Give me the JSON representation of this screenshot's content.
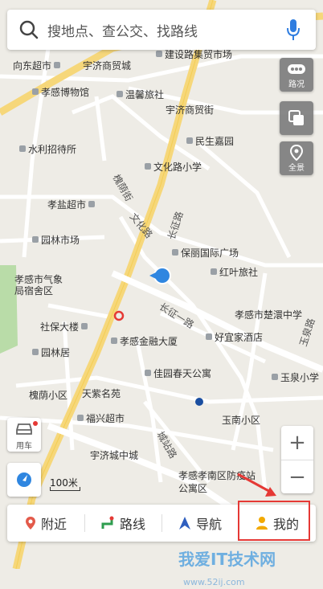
{
  "search": {
    "placeholder": "搜地点、查公交、找路线"
  },
  "side_buttons": {
    "traffic": "路况",
    "panorama": "全景"
  },
  "left_buttons": {
    "car": "用车"
  },
  "zoom": {
    "plus": "+",
    "minus": "−"
  },
  "scale": "100米",
  "bottom_nav": [
    {
      "label": "附近"
    },
    {
      "label": "路线"
    },
    {
      "label": "导航"
    },
    {
      "label": "我的"
    }
  ],
  "watermark": {
    "text": "我爱IT技术网",
    "url": "www.52ij.com"
  },
  "pois": [
    {
      "name": "建设路集贸市场"
    },
    {
      "name": "向东超市"
    },
    {
      "name": "宇济商贸城"
    },
    {
      "name": "孝感博物馆"
    },
    {
      "name": "温馨旅社"
    },
    {
      "name": "宇济商贸街"
    },
    {
      "name": "民生嘉园"
    },
    {
      "name": "水利招待所"
    },
    {
      "name": "文化路小学"
    },
    {
      "name": "孝盐超市"
    },
    {
      "name": "园林市场"
    },
    {
      "name": "保丽国际广场"
    },
    {
      "name": "红叶旅社"
    },
    {
      "name": "孝感市气象局宿舍区"
    },
    {
      "name": "孝感市楚澴中学"
    },
    {
      "name": "社保大楼"
    },
    {
      "name": "好宜家酒店"
    },
    {
      "name": "孝感金融大厦"
    },
    {
      "name": "园林居"
    },
    {
      "name": "佳园春天公寓"
    },
    {
      "name": "玉泉小学"
    },
    {
      "name": "槐荫小区"
    },
    {
      "name": "天紫名苑"
    },
    {
      "name": "福兴超市"
    },
    {
      "name": "玉南小区"
    },
    {
      "name": "宇济城中城"
    },
    {
      "name": "孝感孝南区防疫站公寓区"
    }
  ],
  "roads": [
    {
      "name": "长征路"
    },
    {
      "name": "文化路"
    },
    {
      "name": "长征一路"
    },
    {
      "name": "槐荫街"
    },
    {
      "name": "城站路"
    },
    {
      "name": "玉泉路"
    }
  ]
}
